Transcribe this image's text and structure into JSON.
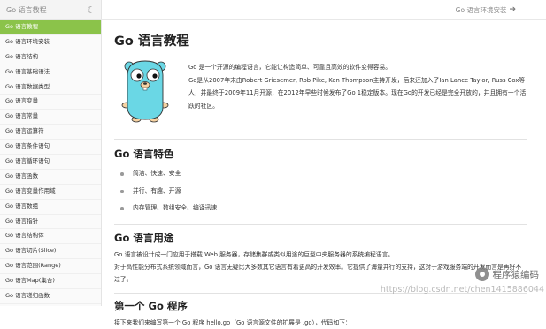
{
  "sidebar": {
    "header_title": "Go 语言教程",
    "theme_icon": "moon-icon",
    "items": [
      "Go 语言教程",
      "Go 语言环境安装",
      "Go 语言结构",
      "Go 语言基础语法",
      "Go 语言数据类型",
      "Go 语言变量",
      "Go 语言常量",
      "Go 语言运算符",
      "Go 语言条件语句",
      "Go 语言循环语句",
      "Go 语言函数",
      "Go 语言变量作用域",
      "Go 语言数组",
      "Go 语言指针",
      "Go 语言结构体",
      "Go 语言切片(Slice)",
      "Go 语言范围(Range)",
      "Go 语言Map(集合)",
      "Go 语言递归函数",
      "Go 语言类型转换"
    ],
    "active_index": 0
  },
  "topbar": {
    "next_link": "Go 语言环境安装",
    "next_icon": "arrow-right-icon"
  },
  "main": {
    "title": "Go 语言教程",
    "logo_icon": "go-gopher-logo",
    "intro": [
      "Go 是一个开源的编程语言，它能让构造简单、可靠且高效的软件变得容易。",
      "Go是从2007年末由Robert Griesemer, Rob Pike, Ken Thompson主持开发，后来还加入了Ian Lance Taylor, Russ Cox等人，并最终于2009年11月开源，在2012年早些时候发布了Go 1稳定版本。现在Go的开发已经是完全开放的，并且拥有一个活跃的社区。"
    ],
    "features_title": "Go 语言特色",
    "features": [
      "简洁、快速、安全",
      "并行、有趣、开源",
      "内存管理、数组安全、编译迅速"
    ],
    "usage_title": "Go 语言用途",
    "usage_text": [
      "Go 语言被设计成一门应用于搭载 Web 服务器，存储集群或类似用途的巨型中央服务器的系统编程语言。",
      "对于高性能分布式系统领域而言，Go 语言无疑比大多数其它语言有着更高的开发效率。它提供了海量并行的支持，这对于游戏服务端的开发而言是再好不过了。"
    ],
    "first_program_title": "第一个 Go 程序",
    "first_program_text": "接下来我们来编写第一个 Go 程序 hello.go（Go 语言源文件的扩展是 .go），代码如下："
  },
  "watermark": {
    "account": "程序猿编码",
    "url": "https://blog.csdn.net/chen1415886044"
  },
  "colors": {
    "active_item_bg": "#8bc34a",
    "gopher": "#6ad7e5"
  }
}
